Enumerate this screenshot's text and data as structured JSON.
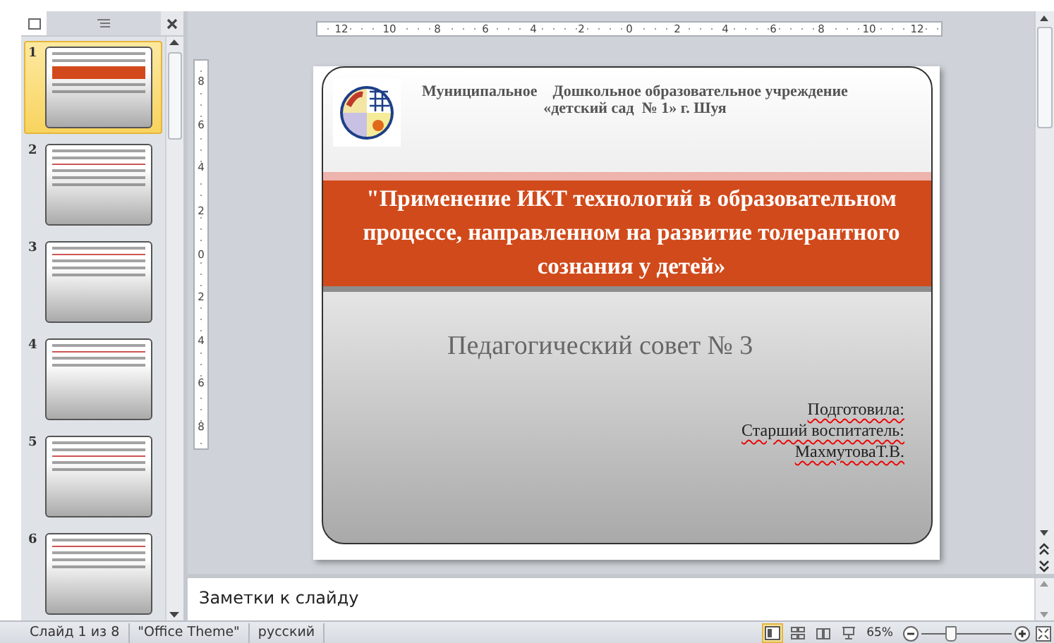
{
  "thumbnails": [
    {
      "number": "1",
      "selected": true
    },
    {
      "number": "2",
      "selected": false
    },
    {
      "number": "3",
      "selected": false
    },
    {
      "number": "4",
      "selected": false
    },
    {
      "number": "5",
      "selected": false
    },
    {
      "number": "6",
      "selected": false
    }
  ],
  "ruler": {
    "horizontal": [
      "12",
      "10",
      "8",
      "6",
      "4",
      "2",
      "0",
      "2",
      "4",
      "6",
      "8",
      "10",
      "12"
    ],
    "vertical": [
      "8",
      "6",
      "4",
      "2",
      "0",
      "2",
      "4",
      "6",
      "8"
    ]
  },
  "slide": {
    "header": [
      "Муниципальное    Дошкольное образовательное учреждение",
      "«детский сад  № 1» г. Шуя"
    ],
    "title": "\"Применение ИКТ технологий в образовательном процессе, направленном на развитие  толерантного сознания у детей»",
    "subtitle": "Педагогический совет № 3",
    "signature": [
      {
        "text": "Подготовила:",
        "misspelled": true
      },
      {
        "text": "Старший воспитатель:",
        "misspelled": true
      },
      {
        "text": "МахмутоваТ.В.",
        "misspelled": true
      }
    ]
  },
  "notes": {
    "placeholder": "Заметки к слайду"
  },
  "status_bar": {
    "slide_info": "Слайд 1 из 8",
    "theme": "\"Office Theme\"",
    "language": "русский",
    "views": [
      {
        "kind": "normal",
        "selected": true
      },
      {
        "kind": "sorter",
        "selected": false
      },
      {
        "kind": "reading",
        "selected": false
      },
      {
        "kind": "show",
        "selected": false
      }
    ],
    "zoom": "65%",
    "zoom_level": {
      "level": 0.33
    }
  }
}
